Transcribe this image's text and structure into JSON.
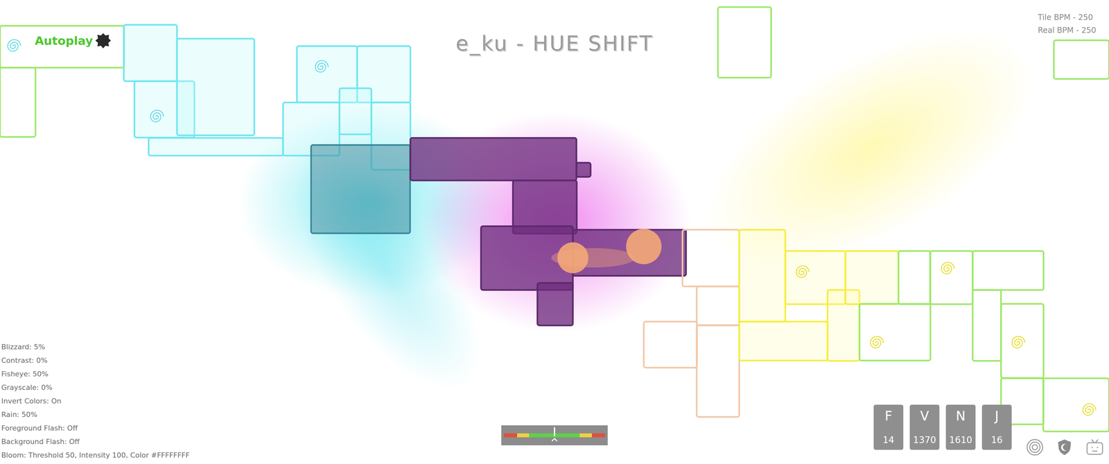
{
  "title": "e_ku - HUE SHIFT",
  "autoplay": {
    "label": "Autoplay",
    "on": true
  },
  "bpm": [
    "Tile BPM - 250",
    "Real BPM - 250"
  ],
  "settings": [
    "Blizzard: 5%",
    "Contrast: 0%",
    "Fisheye: 50%",
    "Grayscale: 0%",
    "Invert Colors: On",
    "Rain: 50%",
    "Foreground Flash: Off",
    "Background Flash: Off",
    "Bloom: Threshold 50, Intensity 100, Color #FFFFFFFF"
  ],
  "accuracy_meter": {
    "level": 0.5,
    "zones": [
      {
        "color": "#e0503c",
        "level": 0.13
      },
      {
        "color": "#f0d040",
        "level": 0.12
      },
      {
        "color": "#5ed14a",
        "level": 0.5
      },
      {
        "color": "#f0d040",
        "level": 0.12
      },
      {
        "color": "#e0503c",
        "level": 0.13
      }
    ]
  },
  "keys": [
    {
      "key": "F",
      "count": "14"
    },
    {
      "key": "V",
      "count": "1370"
    },
    {
      "key": "N",
      "count": "1610"
    },
    {
      "key": "J",
      "count": "16"
    }
  ]
}
